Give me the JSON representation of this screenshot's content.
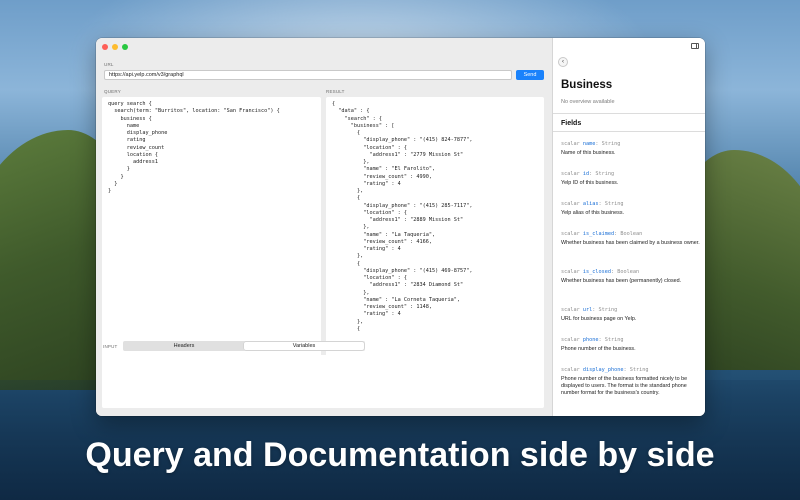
{
  "window": {
    "url_label": "URL",
    "url_value": "https://api.yelp.com/v3/graphql",
    "send_label": "Send",
    "query_label": "QUERY",
    "result_label": "RESULT",
    "input_label": "INPUT",
    "tabs": [
      {
        "label": "Headers",
        "active": false
      },
      {
        "label": "Variables",
        "active": true
      }
    ],
    "query_text": "query search {\n  search(term: \"Burritos\", location: \"San Francisco\") {\n    business {\n      name\n      display_phone\n      rating\n      review_count\n      location {\n        address1\n      }\n    }\n  }\n}",
    "result_text": "{\n  \"data\" : {\n    \"search\" : {\n      \"business\" : [\n        {\n          \"display_phone\" : \"(415) 824-7877\",\n          \"location\" : {\n            \"address1\" : \"2779 Mission St\"\n          },\n          \"name\" : \"El Farolito\",\n          \"review_count\" : 4990,\n          \"rating\" : 4\n        },\n        {\n          \"display_phone\" : \"(415) 285-7117\",\n          \"location\" : {\n            \"address1\" : \"2889 Mission St\"\n          },\n          \"name\" : \"La Taqueria\",\n          \"review_count\" : 4166,\n          \"rating\" : 4\n        },\n        {\n          \"display_phone\" : \"(415) 469-8757\",\n          \"location\" : {\n            \"address1\" : \"2834 Diamond St\"\n          },\n          \"name\" : \"La Corneta Taqueria\",\n          \"review_count\" : 1148,\n          \"rating\" : 4\n        },\n        {"
  },
  "docs": {
    "back_glyph": "‹",
    "title": "Business",
    "overview": "No overview available",
    "fields_heading": "Fields",
    "fields": [
      {
        "kind": "scalar",
        "name": "name",
        "type": "String",
        "description": "Name of this business."
      },
      {
        "kind": "scalar",
        "name": "id",
        "type": "String",
        "description": "Yelp ID of this business."
      },
      {
        "kind": "scalar",
        "name": "alias",
        "type": "String",
        "description": "Yelp alias of this business."
      },
      {
        "kind": "scalar",
        "name": "is_claimed",
        "type": "Boolean",
        "description": "Whether business has been claimed by a business owner."
      },
      {
        "kind": "scalar",
        "name": "is_closed",
        "type": "Boolean",
        "description": "Whether business has been (permanently) closed."
      },
      {
        "kind": "scalar",
        "name": "url",
        "type": "String",
        "description": "URL for business page on Yelp."
      },
      {
        "kind": "scalar",
        "name": "phone",
        "type": "String",
        "description": "Phone number of the business."
      },
      {
        "kind": "scalar",
        "name": "display_phone",
        "type": "String",
        "description": "Phone number of the business formatted nicely to be displayed to users. The format is the standard phone number format for the business's country."
      }
    ]
  },
  "caption": "Query and Documentation side by side",
  "colors": {
    "accent": "#1a82fb",
    "field_name": "#1a6fd6"
  }
}
